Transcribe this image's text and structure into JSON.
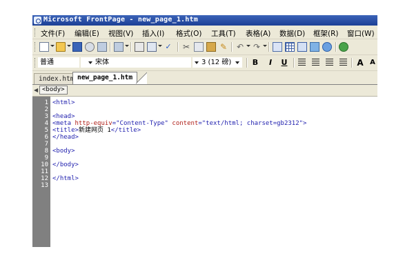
{
  "window": {
    "title": "Microsoft FrontPage - new_page_1.htm"
  },
  "menu": [
    {
      "label": "文件(F)"
    },
    {
      "label": "编辑(E)"
    },
    {
      "label": "视图(V)"
    },
    {
      "label": "插入(I)"
    },
    {
      "label": "格式(O)"
    },
    {
      "label": "工具(T)"
    },
    {
      "label": "表格(A)"
    },
    {
      "label": "数据(D)"
    },
    {
      "label": "框架(R)"
    },
    {
      "label": "窗口(W)"
    }
  ],
  "toolbar_icons": [
    "new-page-icon",
    "open-icon",
    "save-icon",
    "find-icon",
    "web-component-icon",
    "print-icon",
    "preview-icon",
    "spelling-icon",
    "cut-icon",
    "copy-icon",
    "paste-icon",
    "format-painter-icon",
    "undo-icon",
    "redo-icon",
    "hyperlink-icon",
    "insert-table-icon",
    "insert-layer-icon",
    "insert-picture-icon",
    "web-icon",
    "refresh-icon"
  ],
  "format": {
    "style": "普通",
    "font": "宋体",
    "size": "3 (12 磅)",
    "bold": "B",
    "italic": "I",
    "underline": "U",
    "grow_font": "A"
  },
  "tabs": [
    {
      "label": "index.htm",
      "active": false
    },
    {
      "label": "new_page_1.htm",
      "active": true
    }
  ],
  "tag_selector": "<body>",
  "editor": {
    "line_numbers": [
      "1",
      "2",
      "3",
      "4",
      "5",
      "6",
      "7",
      "8",
      "9",
      "10",
      "11",
      "12",
      "13"
    ],
    "lines": {
      "l1": "<html>",
      "l3": "<head>",
      "l4_open": "<meta ",
      "l4_attr1": "http-equiv",
      "l4_val1": "=\"Content-Type\" ",
      "l4_attr2": "content",
      "l4_val2": "=\"text/html; charset=gb2312\">",
      "l5_open": "<title>",
      "l5_text": "新建网页 1",
      "l5_close": "</title>",
      "l6": "</head>",
      "l8": "<body>",
      "l10": "</body>",
      "l12": "</html>"
    }
  },
  "colors": {
    "tag": "#1f1fae",
    "attribute": "#b0201a",
    "gutter": "#808080",
    "titlebar": "#1c3f95"
  }
}
